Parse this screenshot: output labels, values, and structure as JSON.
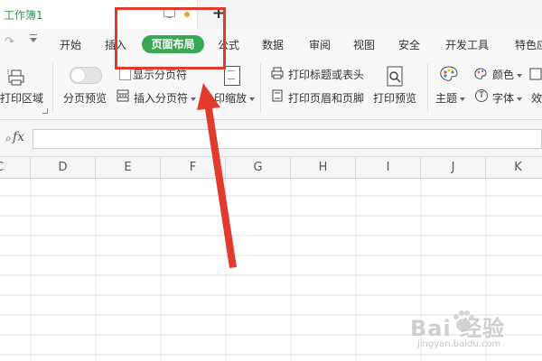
{
  "title_bar": {
    "workbook_name": "工作簿1",
    "new_tab_label": "+"
  },
  "menu": {
    "items": [
      {
        "label": "开始"
      },
      {
        "label": "插入"
      },
      {
        "label": "页面布局",
        "active": true
      },
      {
        "label": "公式"
      },
      {
        "label": "数据"
      },
      {
        "label": "审阅"
      },
      {
        "label": "视图"
      },
      {
        "label": "安全"
      },
      {
        "label": "开发工具"
      },
      {
        "label": "特色应"
      }
    ]
  },
  "ribbon": {
    "print_area": "打印区域",
    "page_preview": "分页预览",
    "show_page_breaks": "显示分页符",
    "insert_page_break": "插入分页符",
    "print_scale": "印缩放",
    "print_titles": "打印标题或表头",
    "print_header_footer": "打印页眉和页脚",
    "print_preview": "打印预览",
    "theme": "主题",
    "colors": "颜色",
    "font": "字体",
    "effects": "效"
  },
  "formula_bar": {
    "fx_label": "fx",
    "value": ""
  },
  "grid": {
    "columns": [
      "C",
      "D",
      "E",
      "F",
      "G",
      "H",
      "I",
      "J",
      "K"
    ]
  },
  "annotation": {
    "highlight_color": "#e23a2e",
    "accent_color": "#3aa755"
  },
  "watermark": {
    "brand": "Bai 经验",
    "url": "jingyan.baidu.com"
  }
}
